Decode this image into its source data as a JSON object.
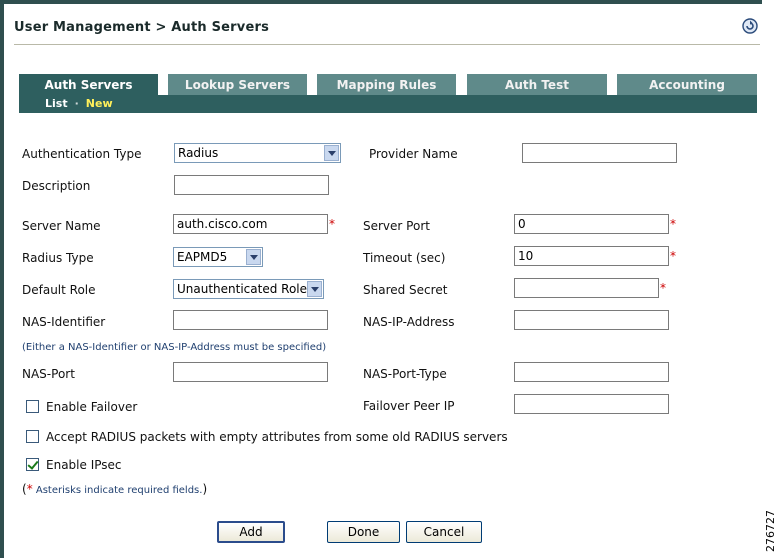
{
  "header": {
    "breadcrumb": "User Management > Auth Servers",
    "help_icon": "help-circle-arrow-icon"
  },
  "tabs": [
    {
      "label": "Auth Servers",
      "active": true
    },
    {
      "label": "Lookup Servers",
      "active": false
    },
    {
      "label": "Mapping Rules",
      "active": false
    },
    {
      "label": "Auth Test",
      "active": false
    },
    {
      "label": "Accounting",
      "active": false
    }
  ],
  "subnav": {
    "list": "List",
    "separator": "·",
    "new": "New"
  },
  "form": {
    "auth_type": {
      "label": "Authentication Type",
      "value": "Radius"
    },
    "provider_name": {
      "label": "Provider Name",
      "value": ""
    },
    "description": {
      "label": "Description",
      "value": ""
    },
    "server_name": {
      "label": "Server Name",
      "value": "auth.cisco.com"
    },
    "server_port": {
      "label": "Server Port",
      "value": "0"
    },
    "radius_type": {
      "label": "Radius Type",
      "value": "EAPMD5"
    },
    "timeout": {
      "label": "Timeout (sec)",
      "value": "10"
    },
    "default_role": {
      "label": "Default Role",
      "value": "Unauthenticated Role"
    },
    "shared_secret": {
      "label": "Shared Secret",
      "value": ""
    },
    "nas_identifier": {
      "label": "NAS-Identifier",
      "value": ""
    },
    "nas_ip_address": {
      "label": "NAS-IP-Address",
      "value": ""
    },
    "nas_note": "(Either a NAS-Identifier or NAS-IP-Address must be specified)",
    "nas_port": {
      "label": "NAS-Port",
      "value": ""
    },
    "nas_port_type": {
      "label": "NAS-Port-Type",
      "value": ""
    },
    "enable_failover": {
      "label": "Enable Failover",
      "checked": false
    },
    "failover_peer_ip": {
      "label": "Failover Peer IP",
      "value": ""
    },
    "accept_radius": {
      "label": "Accept RADIUS packets with empty attributes from some old RADIUS servers",
      "checked": false
    },
    "enable_ipsec": {
      "label": "Enable IPsec",
      "checked": true
    },
    "required_note": {
      "open": "(",
      "star": "*",
      "text": " Asterisks indicate required fields.",
      "close": ")"
    },
    "required_marker": "*"
  },
  "buttons": {
    "add": "Add",
    "done": "Done",
    "cancel": "Cancel"
  },
  "figure_id": "276727",
  "colors": {
    "tab_active": "#2e5f5f",
    "tab_inactive": "#5f8a8a",
    "subnav_new": "#ffef5a",
    "required": "#cc0000"
  }
}
